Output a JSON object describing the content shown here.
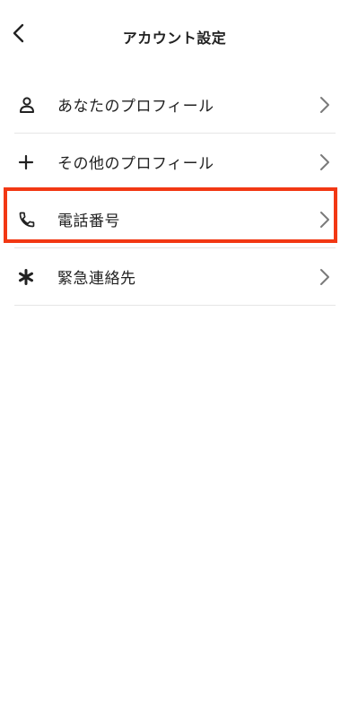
{
  "header": {
    "title": "アカウント設定",
    "back_icon": "chevron-left-icon"
  },
  "menu": {
    "items": [
      {
        "label": "あなたのプロフィール",
        "icon": "person-icon"
      },
      {
        "label": "その他のプロフィール",
        "icon": "plus-icon"
      },
      {
        "label": "電話番号",
        "icon": "phone-icon"
      },
      {
        "label": "緊急連絡先",
        "icon": "asterisk-icon"
      }
    ],
    "chevron_icon": "chevron-right-icon"
  },
  "colors": {
    "text": "#222222",
    "chevron": "#7a7a7a",
    "divider": "#e6e6e6",
    "highlight": "#f23814"
  }
}
